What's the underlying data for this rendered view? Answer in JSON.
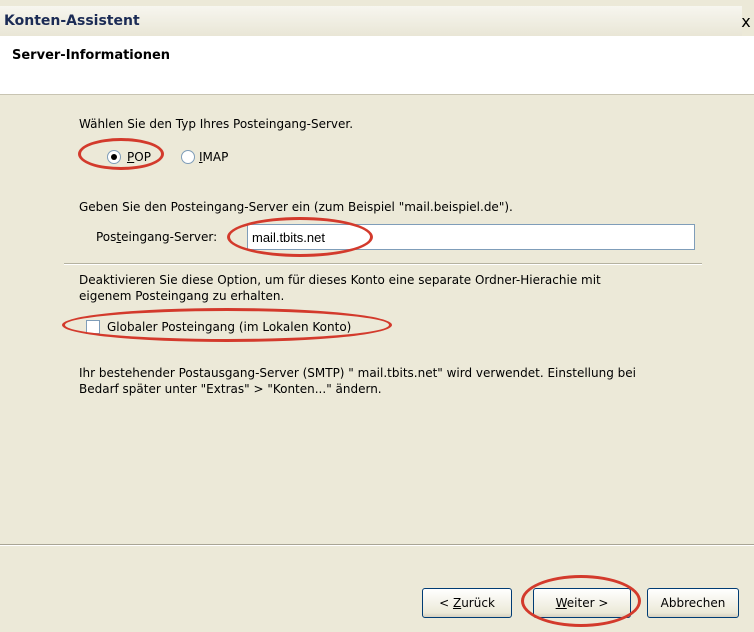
{
  "window": {
    "title": "Konten-Assistent",
    "close_glyph": "x",
    "close_icon": "close-icon"
  },
  "header": {
    "title": "Server-Informationen"
  },
  "server_type": {
    "prompt": "Wählen Sie den Typ Ihres Posteingang-Server.",
    "options": [
      {
        "label": "POP",
        "checked": true
      },
      {
        "label": "IMAP",
        "checked": false
      }
    ]
  },
  "incoming_server": {
    "instruction": "Geben Sie den Posteingang-Server ein (zum Beispiel \"mail.beispiel.de\").",
    "label": "Posteingang-Server:",
    "value": "mail.tbits.net"
  },
  "global_inbox": {
    "description_line1": "Deaktivieren Sie diese Option, um für dieses Konto eine separate Ordner-Hierachie mit",
    "description_line2": "eigenem Posteingang zu erhalten.",
    "checkbox_label": "Globaler Posteingang (im Lokalen Konto)",
    "checked": false
  },
  "smtp_info": {
    "line1": "Ihr bestehender Postausgang-Server (SMTP) \" mail.tbits.net\" wird verwendet. Einstellung bei",
    "line2": "Bedarf später unter \"Extras\" > \"Konten...\" ändern."
  },
  "buttons": {
    "back": "< Zurück",
    "next": "Weiter >",
    "cancel": "Abbrechen"
  },
  "annotation_color": "#d33a2c"
}
